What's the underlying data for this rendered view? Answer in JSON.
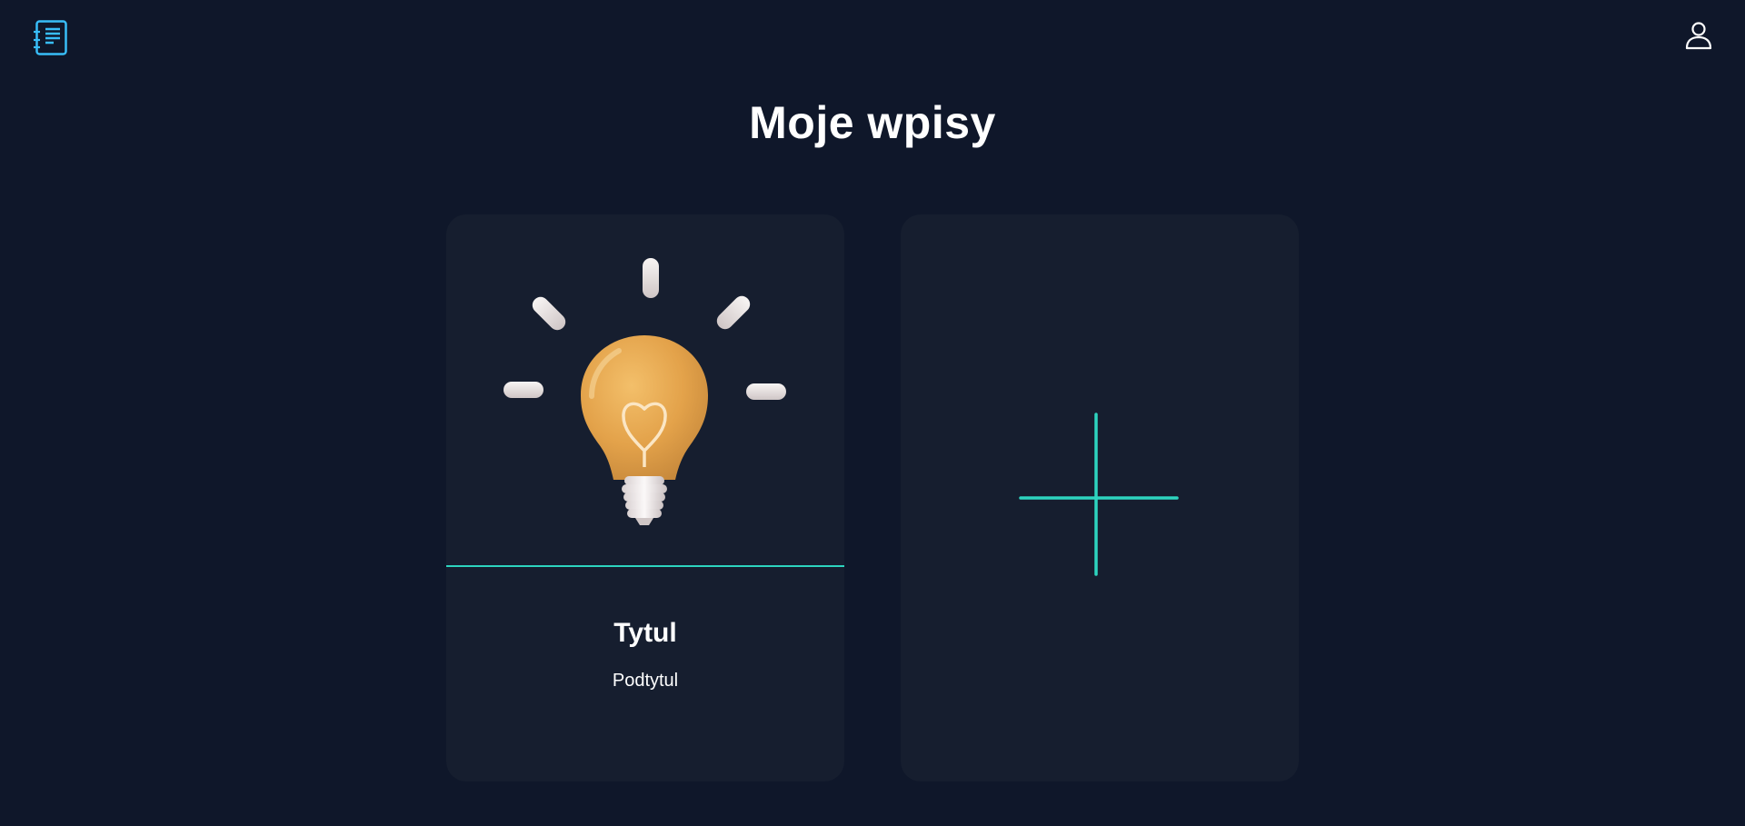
{
  "header": {
    "logo_icon": "notebook-list-icon",
    "user_icon": "user-profile-icon",
    "accent_color": "#38bdf8"
  },
  "page": {
    "title": "Moje wpisy"
  },
  "entries": [
    {
      "image_icon": "lightbulb-icon",
      "title": "Tytul",
      "subtitle": "Podtytul"
    }
  ],
  "add_card": {
    "icon": "plus-icon",
    "color": "#2dd4bf"
  },
  "colors": {
    "background": "#0f172a",
    "card": "#161e2f",
    "accent": "#2dd4bf",
    "text": "#ffffff"
  }
}
